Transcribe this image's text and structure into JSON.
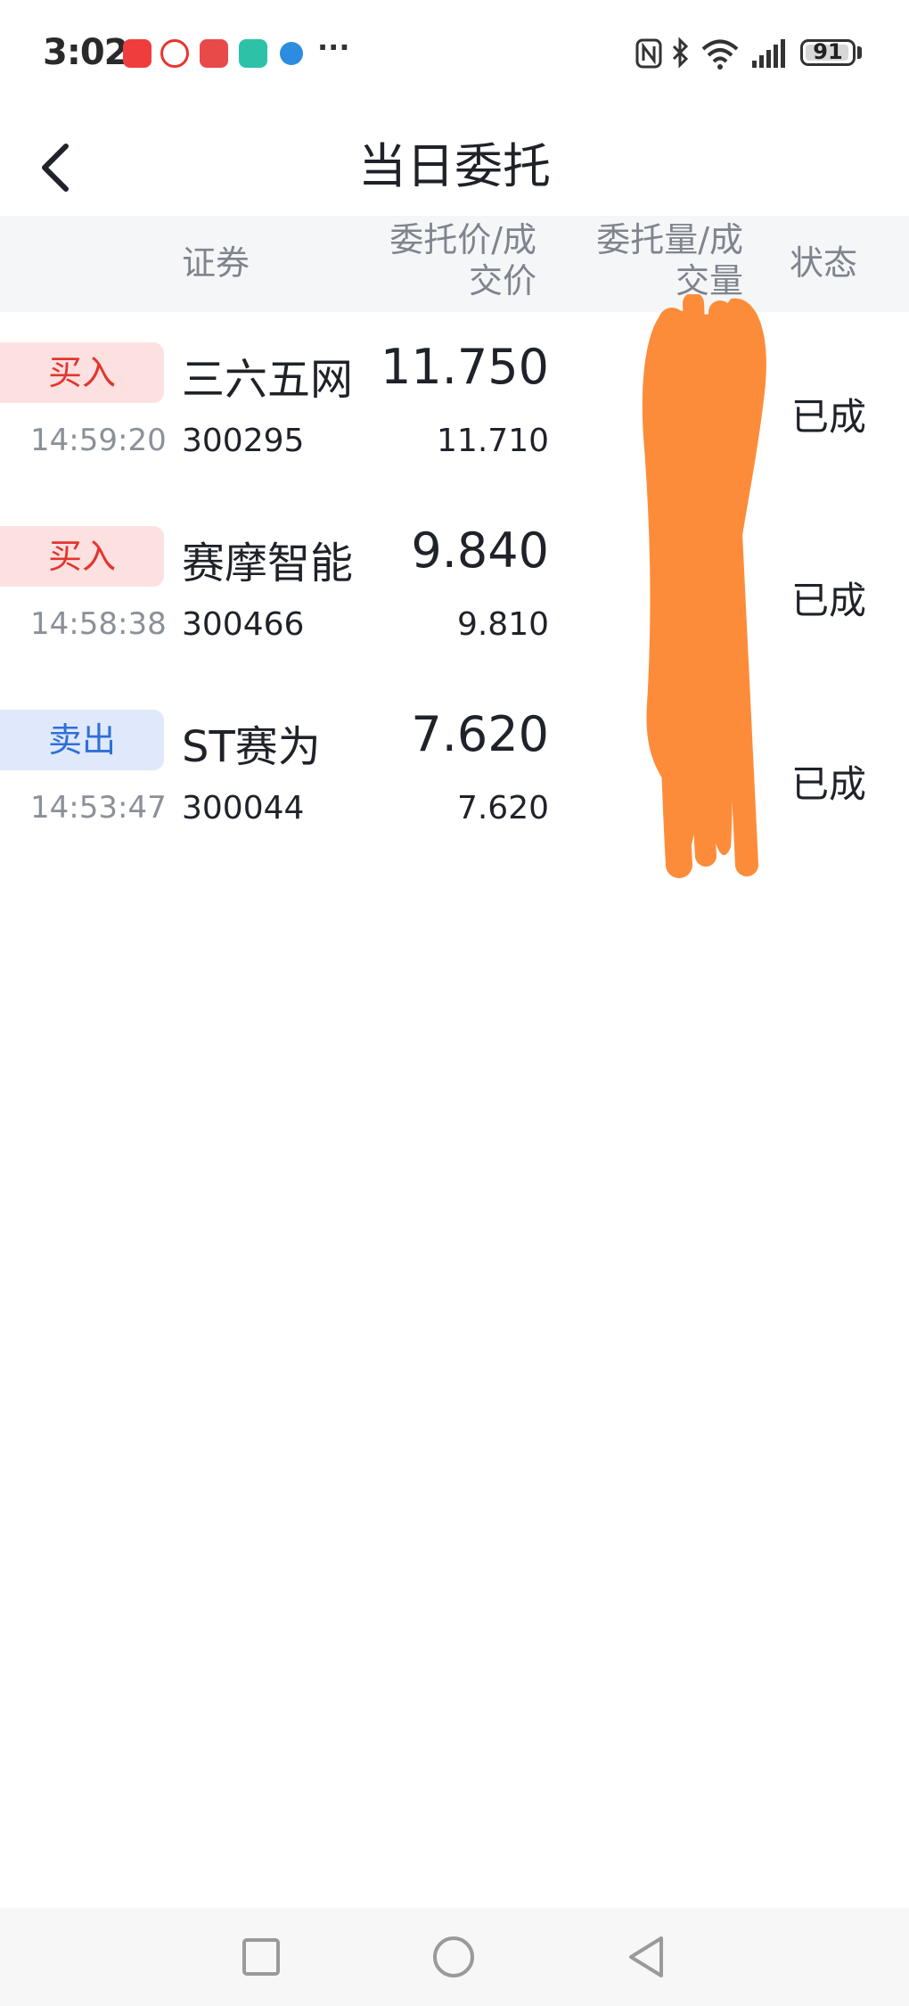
{
  "status_bar": {
    "time": "3:02",
    "more": "···",
    "battery": "91"
  },
  "nav": {
    "title": "当日委托"
  },
  "table": {
    "headers": {
      "security": "证券",
      "price": "委托价/成\n交价",
      "volume": "委托量/成\n交量",
      "status": "状态"
    },
    "rows": [
      {
        "side": "买入",
        "side_type": "buy",
        "time": "14:59:20",
        "name": "三六五网",
        "code": "300295",
        "order_price": "11.750",
        "deal_price": "11.710",
        "status": "已成"
      },
      {
        "side": "买入",
        "side_type": "buy",
        "time": "14:58:38",
        "name": "赛摩智能",
        "code": "300466",
        "order_price": "9.840",
        "deal_price": "9.810",
        "status": "已成"
      },
      {
        "side": "卖出",
        "side_type": "sell",
        "time": "14:53:47",
        "name": "ST赛为",
        "code": "300044",
        "order_price": "7.620",
        "deal_price": "7.620",
        "status": "已成"
      }
    ]
  },
  "colors": {
    "buy": "#e2362f",
    "sell": "#2f6fd8",
    "redaction": "#fd8c3a"
  }
}
